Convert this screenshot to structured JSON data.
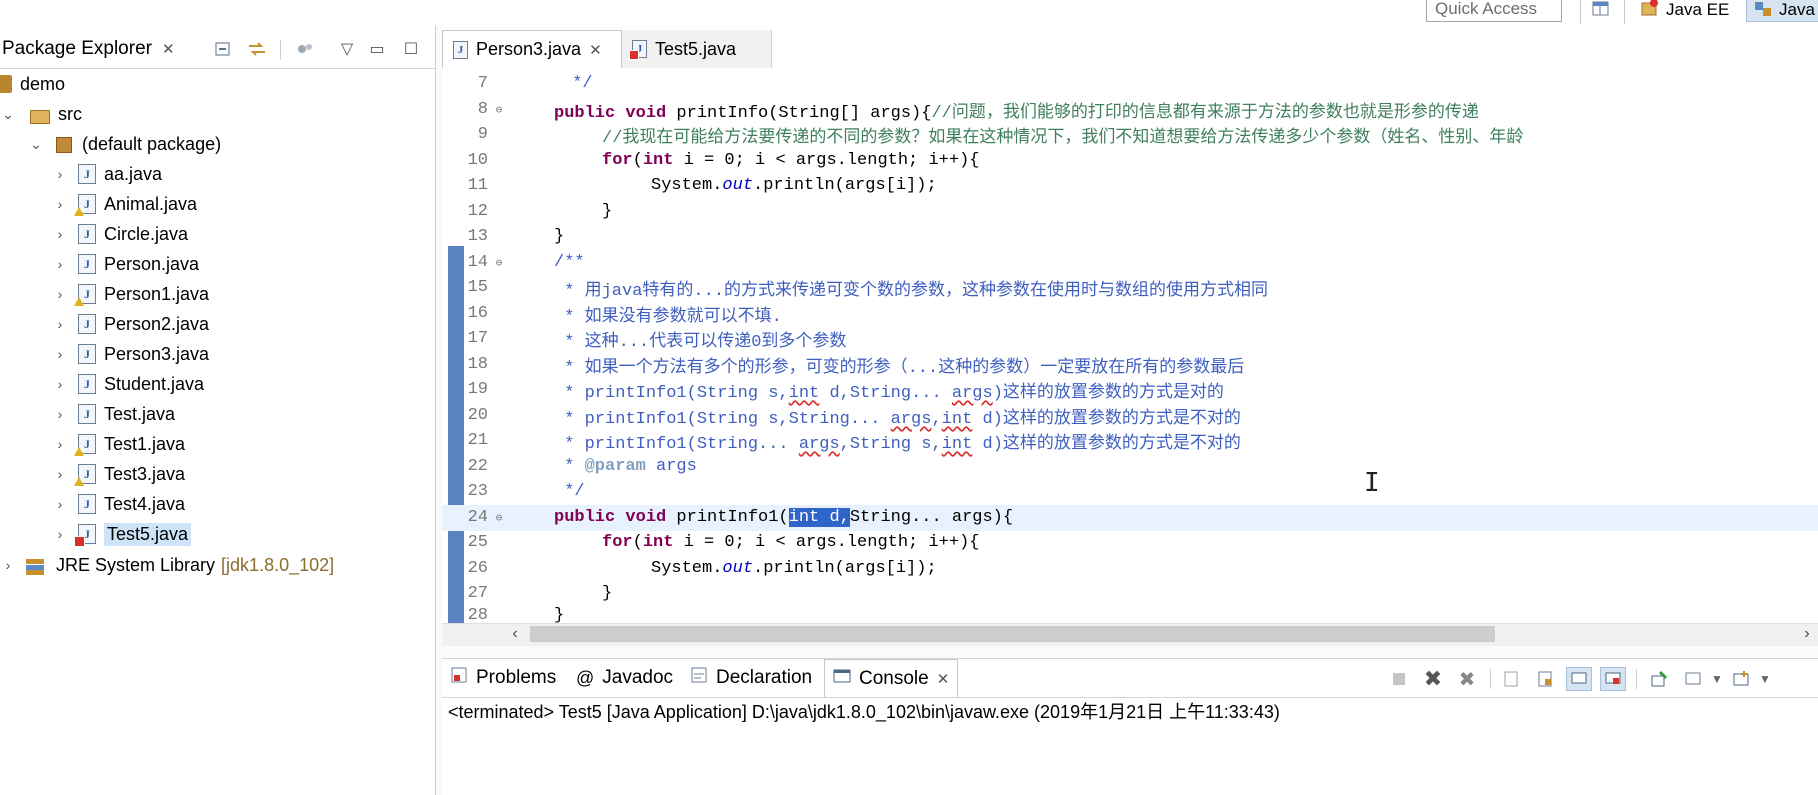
{
  "toolbar": {
    "quick_access_placeholder": "Quick Access",
    "perspectives": [
      "Java EE",
      "Java"
    ]
  },
  "explorer": {
    "tab_label": "Package Explorer",
    "tree": {
      "project": "demo",
      "src": "src",
      "package": "(default package)",
      "files": [
        "aa.java",
        "Animal.java",
        "Circle.java",
        "Person.java",
        "Person1.java",
        "Person2.java",
        "Person3.java",
        "Student.java",
        "Test.java",
        "Test1.java",
        "Test3.java",
        "Test4.java",
        "Test5.java"
      ],
      "library": "JRE System Library",
      "library_version": "[jdk1.8.0_102]"
    }
  },
  "editor": {
    "tabs": [
      "Person3.java",
      "Test5.java"
    ],
    "lines": {
      "n7": "7",
      "n8": "8",
      "n9": "9",
      "n10": "10",
      "n11": "11",
      "n12": "12",
      "n13": "13",
      "n14": "14",
      "n15": "15",
      "n16": "16",
      "n17": "17",
      "n18": "18",
      "n19": "19",
      "n20": "20",
      "n21": "21",
      "n22": "22",
      "n23": "23",
      "n24": "24",
      "n25": "25",
      "n26": "26",
      "n27": "27",
      "n28": "28"
    },
    "code": {
      "l7": " */",
      "l8_kw": "public void",
      "l8_a": " printInfo(String[] args){",
      "l8_cmt": "//问题，我们能够的打印的信息都有来源于方法的参数也就是形参的传递",
      "l9_cmt": "//我现在可能给方法要传递的不同的参数？如果在这种情况下，我们不知道想要给方法传递多少个参数（姓名、性别、年龄",
      "l10_kw": "for",
      "l10_a": "(",
      "l10_kw2": "int",
      "l10_b": " i = 0; i < args.length; i++){",
      "l11_a": "System.",
      "l11_fld": "out",
      "l11_b": ".println(args[i]);",
      "l12": "}",
      "l13": "}",
      "l14": "/**",
      "l15": " * 用java特有的...的方式来传递可变个数的参数，这种参数在使用时与数组的使用方式相同",
      "l16": " * 如果没有参数就可以不填.",
      "l17": " * 这种...代表可以传递0到多个参数",
      "l18": " * 如果一个方法有多个的形参，可变的形参（...这种的参数）一定要放在所有的参数最后",
      "l19_a": " * printInfo1(String s,",
      "l19_sq1": "int",
      "l19_b": " d,String... ",
      "l19_sq2": "args",
      "l19_c": ")这样的放置参数的方式是对的",
      "l20_a": " * printInfo1(String s,String... ",
      "l20_sq1": "args",
      "l20_b": ",",
      "l20_sq2": "int",
      "l20_c": " d)这样的放置参数的方式是不对的",
      "l21_a": " * printInfo1(String... ",
      "l21_sq1": "args",
      "l21_b": ",String s,",
      "l21_sq2": "int",
      "l21_c": " d)这样的放置参数的方式是不对的",
      "l22_a": " * ",
      "l22_tag": "@param",
      "l22_b": " args",
      "l23": " */",
      "l24_kw": "public void",
      "l24_a": " printInfo1(",
      "l24_sel": "int d,",
      "l24_b": "String... args){",
      "l25_kw": "for",
      "l25_a": "(",
      "l25_kw2": "int",
      "l25_b": " i = 0; i < args.length; i++){",
      "l26_a": "System.",
      "l26_fld": "out",
      "l26_b": ".println(args[i]);",
      "l27": "}",
      "l28": "}"
    }
  },
  "bottom_panel": {
    "tabs": [
      "Problems",
      "Javadoc",
      "Declaration",
      "Console"
    ],
    "status": "<terminated> Test5 [Java Application] D:\\java\\jdk1.8.0_102\\bin\\javaw.exe (2019年1月21日 上午11:33:43)"
  }
}
